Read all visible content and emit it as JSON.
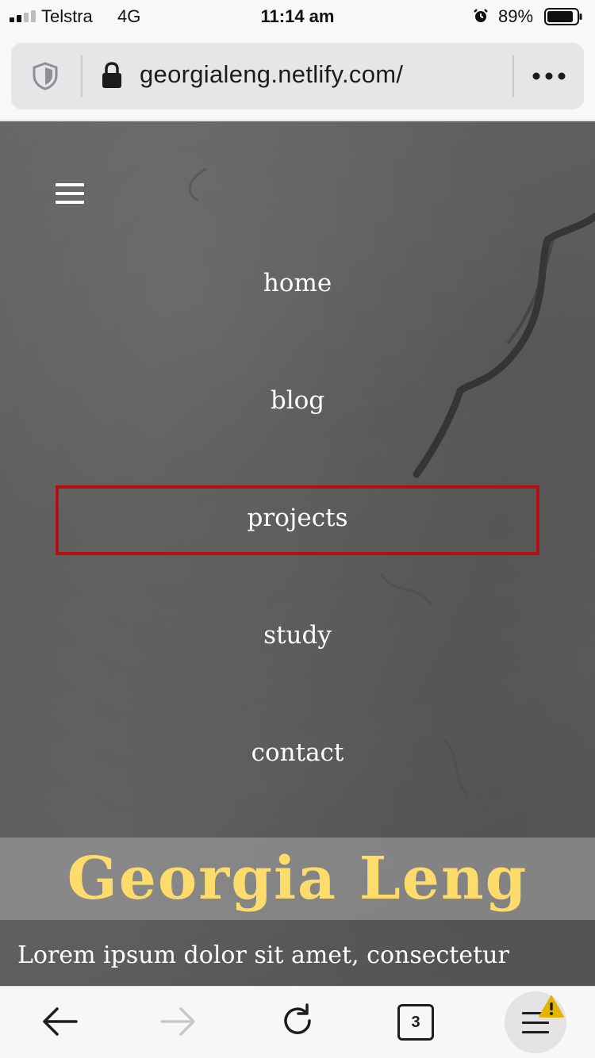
{
  "status_bar": {
    "carrier": "Telstra",
    "network": "4G",
    "time": "11:14 am",
    "battery": "89%",
    "battery_level": 0.89,
    "icons": [
      "signal-icon",
      "alarm-icon",
      "battery-icon"
    ]
  },
  "browser": {
    "url": "georgialeng.netlify.com/",
    "icons": [
      "shield-icon",
      "lock-icon",
      "more-icon"
    ],
    "tab_count": "3"
  },
  "nav": {
    "items": [
      {
        "label": "home"
      },
      {
        "label": "blog"
      },
      {
        "label": "projects"
      },
      {
        "label": "study"
      },
      {
        "label": "contact"
      }
    ],
    "highlighted": "projects",
    "highlight_color": "#b40f12"
  },
  "hero": {
    "title": "Georgia Leng",
    "title_color": "#fddc6b",
    "intro": "Lorem ipsum dolor sit amet, consectetur"
  },
  "toolbar": {
    "icons": [
      "back-icon",
      "forward-icon",
      "reload-icon",
      "tabs-icon",
      "menu-icon",
      "warning-icon"
    ],
    "warning_color": "#e4b400"
  }
}
